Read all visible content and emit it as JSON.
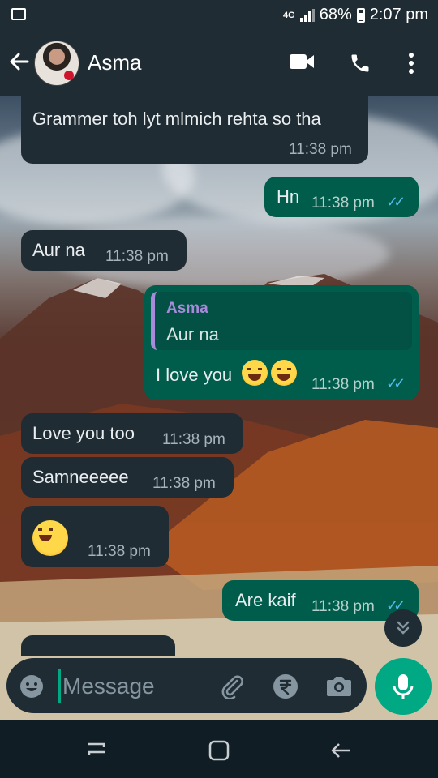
{
  "status_bar": {
    "network": "4G",
    "battery": "68%",
    "time": "2:07 pm"
  },
  "header": {
    "contact_name": "Asma"
  },
  "messages": [
    {
      "dir": "in",
      "text": "Grammer toh lyt mlmich rehta so tha",
      "time": "11:38 pm"
    },
    {
      "dir": "out",
      "text": "Hn",
      "time": "11:38 pm"
    },
    {
      "dir": "in",
      "text": "Aur na",
      "time": "11:38 pm"
    },
    {
      "dir": "out",
      "quote_author": "Asma",
      "quote_text": "Aur na",
      "text": "I love you",
      "time": "11:38 pm"
    },
    {
      "dir": "in",
      "text": "Love you too",
      "time": "11:38 pm"
    },
    {
      "dir": "in",
      "text": "Samneeeee",
      "time": "11:38 pm"
    },
    {
      "dir": "in",
      "text": "",
      "time": "11:38 pm"
    },
    {
      "dir": "out",
      "text": "Are kaif",
      "time": "11:38 pm"
    }
  ],
  "input": {
    "placeholder": "Message"
  },
  "colors": {
    "incoming": "#1f2c34",
    "outgoing": "#005c4b",
    "accent": "#00a884",
    "read_ticks": "#53bdeb",
    "quote_bar": "#a78bda"
  },
  "icons": [
    "back-arrow-icon",
    "video-call-icon",
    "phone-icon",
    "more-menu-icon",
    "emoji-icon",
    "attach-icon",
    "rupee-icon",
    "camera-icon",
    "mic-icon",
    "scroll-down-icon"
  ]
}
